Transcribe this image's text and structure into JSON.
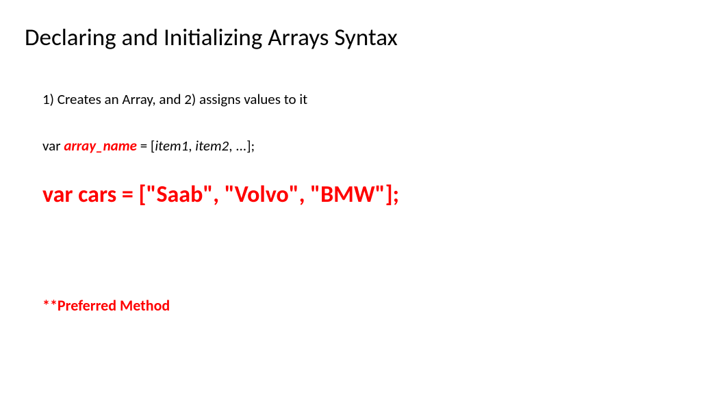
{
  "title": "Declaring and Initializing Arrays Syntax",
  "step": "1) Creates an Array, and 2) assigns values to it",
  "syntax": {
    "var": "var ",
    "array_name": "array_name",
    "equals_bracket": " = [",
    "item1": "item1",
    "sep1": ", ",
    "item2": "item2",
    "rest": ", ...];"
  },
  "example": "var cars = [\"Saab\", \"Volvo\", \"BMW\"];",
  "preferred": "**Preferred Method"
}
